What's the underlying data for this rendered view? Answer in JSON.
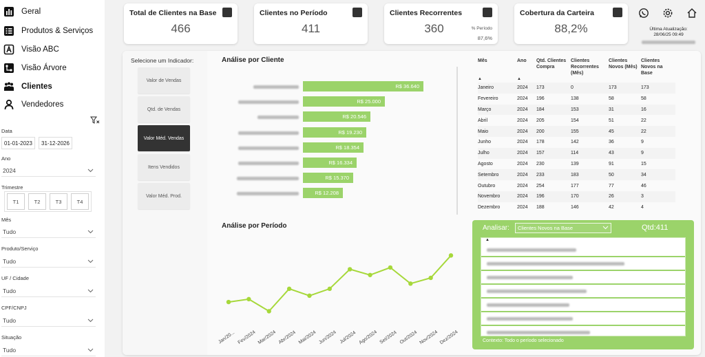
{
  "nav": {
    "items": [
      {
        "label": "Geral",
        "icon": "bar-chart-icon"
      },
      {
        "label": "Produtos & Serviços",
        "icon": "list-icon"
      },
      {
        "label": "Visão ABC",
        "icon": "abc-icon"
      },
      {
        "label": "Visão Árvore",
        "icon": "tree-icon"
      },
      {
        "label": "Clientes",
        "icon": "people-icon"
      },
      {
        "label": "Vendedores",
        "icon": "person-icon"
      }
    ],
    "active": "Clientes"
  },
  "filters": {
    "date_label": "Data",
    "date_start": "01-01-2023",
    "date_end": "31-12-2026",
    "ano_label": "Ano",
    "ano_value": "2024",
    "trimestre_label": "Trimestre",
    "trimestres": [
      "T1",
      "T2",
      "T3",
      "T4"
    ],
    "mes_label": "Mês",
    "mes_value": "Tudo",
    "produto_label": "Produto/Serviço",
    "produto_value": "Tudo",
    "uf_label": "UF / Cidade",
    "uf_value": "Tudo",
    "cpf_label": "CPF/CNPJ",
    "cpf_value": "Tudo",
    "situacao_label": "Situação",
    "situacao_value": "Tudo"
  },
  "kpis": {
    "total_clientes": {
      "title": "Total de Clientes na Base",
      "value": "466"
    },
    "clientes_periodo": {
      "title": "Clientes no Período",
      "value": "411"
    },
    "clientes_recorrentes": {
      "title": "Clientes Recorrentes",
      "value": "360",
      "sub_label": "% Período",
      "sub_value": "87,6%"
    },
    "cobertura": {
      "title": "Cobertura da Carteira",
      "value": "88,2%"
    }
  },
  "header": {
    "updated_label": "Última Atualização:",
    "updated_value": "28/06/25 09:49"
  },
  "indicator": {
    "title": "Selecione um Indicador:",
    "buttons": [
      "Valor de Vendas",
      "Qtd. de Vendas",
      "Valor Méd. Vendas",
      "Itens Vendidos",
      "Valor Méd. Prod."
    ],
    "active_index": 2
  },
  "clients_chart": {
    "title": "Análise por Cliente",
    "type": "bar",
    "values": [
      36640,
      25000,
      20546,
      19230,
      18354,
      16334,
      15370,
      12208
    ],
    "labels": [
      "R$ 36.640",
      "R$ 25.000",
      "R$ 20.546",
      "R$ 19.230",
      "R$ 18.354",
      "R$ 16.334",
      "R$ 15.370",
      "R$ 12.208"
    ]
  },
  "table": {
    "headers": [
      "Mês",
      "Ano",
      "Qtd. Clientes Compra",
      "Clientes Recorrentes (Mês)",
      "Clientes Novos (Mês)",
      "Clientes Novos na Base"
    ],
    "rows": [
      [
        "Janeiro",
        "2024",
        "173",
        "0",
        "173",
        "173"
      ],
      [
        "Fevereiro",
        "2024",
        "196",
        "138",
        "58",
        "58"
      ],
      [
        "Março",
        "2024",
        "184",
        "153",
        "31",
        "16"
      ],
      [
        "Abril",
        "2024",
        "205",
        "154",
        "51",
        "22"
      ],
      [
        "Maio",
        "2024",
        "200",
        "155",
        "45",
        "22"
      ],
      [
        "Junho",
        "2024",
        "178",
        "142",
        "36",
        "9"
      ],
      [
        "Julho",
        "2024",
        "157",
        "114",
        "43",
        "9"
      ],
      [
        "Agosto",
        "2024",
        "230",
        "139",
        "91",
        "15"
      ],
      [
        "Setembro",
        "2024",
        "233",
        "183",
        "50",
        "34"
      ],
      [
        "Outubro",
        "2024",
        "254",
        "177",
        "77",
        "46"
      ],
      [
        "Novembro",
        "2024",
        "196",
        "170",
        "26",
        "3"
      ],
      [
        "Dezembro",
        "2024",
        "188",
        "146",
        "42",
        "4"
      ]
    ]
  },
  "period_chart": {
    "title": "Análise por Período",
    "type": "line",
    "categories": [
      "Jan/20...",
      "Fev/2024",
      "Mar/2024",
      "Abr/2024",
      "Mai/2024",
      "Jun/2024",
      "Jul/2024",
      "Ago/2024",
      "Set/2024",
      "Out/2024",
      "Nov/2024",
      "Dez/2024"
    ],
    "values": [
      173,
      178,
      157,
      196,
      184,
      196,
      230,
      220,
      233,
      205,
      215,
      254
    ],
    "ylim": [
      130,
      270
    ]
  },
  "analyze": {
    "label": "Analisar:",
    "select_value": "Clientes Novos na Base",
    "qtd": "Qtd:411",
    "context": "Contexto: Todo o período selecionado"
  },
  "colors": {
    "accent": "#9bd36a",
    "accent_line": "#a6d83a",
    "dark": "#333333"
  }
}
